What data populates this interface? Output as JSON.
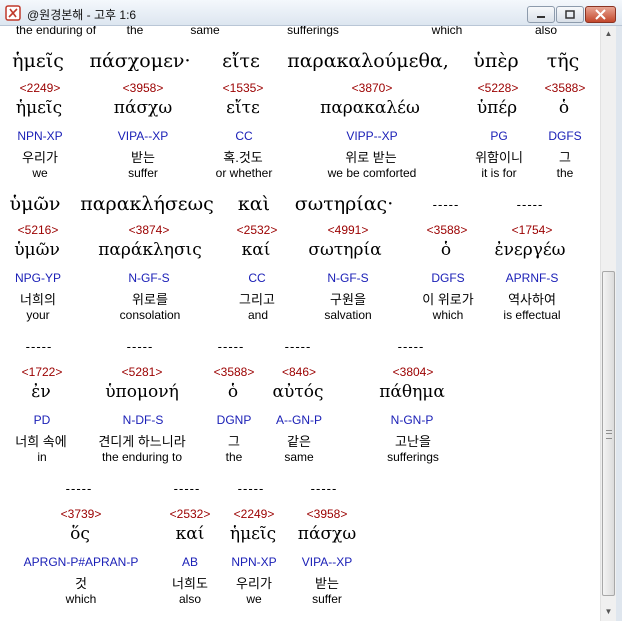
{
  "window": {
    "title": "@원경본해 - 고후 1:6"
  },
  "colors": {
    "strong": "#9b0000",
    "morph": "#1b20b7",
    "text": "#000000"
  },
  "top_partial": [
    {
      "text": "the enduring of"
    },
    {
      "text": "the"
    },
    {
      "text": "same"
    },
    {
      "text": "sufferings"
    },
    {
      "text": "which"
    },
    {
      "text": "also"
    }
  ],
  "blocks": [
    {
      "words": [
        {
          "greek": "ἡμεῖς",
          "strong": "<2249>",
          "lemma": "ἡμεῖς",
          "morph": "NPN-XP",
          "korean": "우리가",
          "english": "we"
        },
        {
          "greek": "πάσχομεν·",
          "strong": "<3958>",
          "lemma": "πάσχω",
          "morph": "VIPA--XP",
          "korean": "받는",
          "english": "suffer"
        },
        {
          "greek": "εἴτε",
          "strong": "<1535>",
          "lemma": "εἴτε",
          "morph": "CC",
          "korean": "혹.것도",
          "english": "or whether"
        },
        {
          "greek": "παρακαλούμεθα,",
          "strong": "<3870>",
          "lemma": "παρακαλέω",
          "morph": "VIPP--XP",
          "korean": "위로 받는",
          "english": "we be comforted"
        },
        {
          "greek": "ὑπὲρ",
          "strong": "<5228>",
          "lemma": "ὑπέρ",
          "morph": "PG",
          "korean": "위함이니",
          "english": "it is for"
        },
        {
          "greek": "τῆς",
          "strong": "<3588>",
          "lemma": "ὁ",
          "morph": "DGFS",
          "korean": "그",
          "english": "the"
        }
      ]
    },
    {
      "words": [
        {
          "greek": "ὑμῶν",
          "strong": "<5216>",
          "lemma": "ὑμῶν",
          "morph": "NPG-YP",
          "korean": "너희의",
          "english": "your"
        },
        {
          "greek": "παρακλήσεως",
          "strong": "<3874>",
          "lemma": "παράκλησις",
          "morph": "N-GF-S",
          "korean": "위로를",
          "english": "consolation"
        },
        {
          "greek": "καὶ",
          "strong": "<2532>",
          "lemma": "καί",
          "morph": "CC",
          "korean": "그리고",
          "english": "and"
        },
        {
          "greek": "σωτηρίας·",
          "strong": "<4991>",
          "lemma": "σωτηρία",
          "morph": "N-GF-S",
          "korean": "구원을",
          "english": "salvation"
        },
        {
          "greek": "-----",
          "strong": "<3588>",
          "lemma": "ὁ",
          "morph": "DGFS",
          "korean": "이 위로가",
          "english": "which"
        },
        {
          "greek": "-----",
          "strong": "<1754>",
          "lemma": "ἐνεργέω",
          "morph": "APRNF-S",
          "korean": "역사하여",
          "english": "is effectual"
        }
      ]
    },
    {
      "words": [
        {
          "greek": "-----",
          "strong": "<1722>",
          "lemma": "ἐν",
          "morph": "PD",
          "korean": "너희 속에",
          "english": "in"
        },
        {
          "greek": "-----",
          "strong": "<5281>",
          "lemma": "ὑπομονή",
          "morph": "N-DF-S",
          "korean": "견디게 하느니라",
          "english": "the enduring to"
        },
        {
          "greek": "-----",
          "strong": "<3588>",
          "lemma": "ὁ",
          "morph": "DGNP",
          "korean": "그",
          "english": "the"
        },
        {
          "greek": "-----",
          "strong": "<846>",
          "lemma": "αὐτός",
          "morph": "A--GN-P",
          "korean": "같은",
          "english": "same"
        },
        {
          "greek": "-----",
          "strong": "<3804>",
          "lemma": "πάθημα",
          "morph": "N-GN-P",
          "korean": "고난을",
          "english": "sufferings"
        }
      ]
    },
    {
      "words": [
        {
          "greek": "-----",
          "strong": "<3739>",
          "lemma": "ὅς",
          "morph": "APRGN-P#APRAN-P",
          "korean": "것",
          "english": "which"
        },
        {
          "greek": "-----",
          "strong": "<2532>",
          "lemma": "καί",
          "morph": "AB",
          "korean": "너희도",
          "english": "also"
        },
        {
          "greek": "-----",
          "strong": "<2249>",
          "lemma": "ἡμεῖς",
          "morph": "NPN-XP",
          "korean": "우리가",
          "english": "we"
        },
        {
          "greek": "-----",
          "strong": "<3958>",
          "lemma": "πάσχω",
          "morph": "VIPA--XP",
          "korean": "받는",
          "english": "suffer"
        }
      ]
    }
  ]
}
